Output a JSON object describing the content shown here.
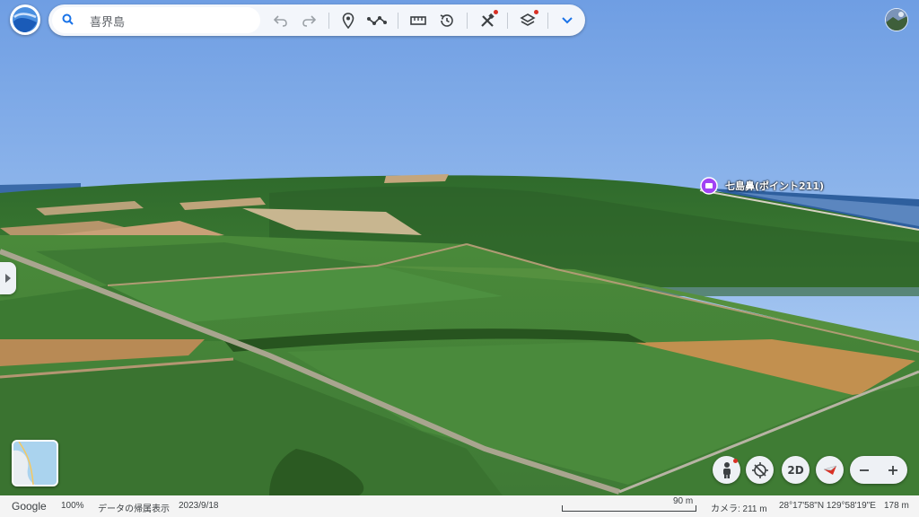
{
  "search": {
    "value": "喜界島"
  },
  "icons": {
    "logo": "google-earth-logo-icon",
    "search": "search-icon",
    "undo": "undo-icon",
    "redo": "redo-icon",
    "pin": "add-placemark-icon",
    "path": "draw-path-icon",
    "measure": "ruler-icon",
    "history": "historical-imagery-icon",
    "tools": "tools-icon",
    "layers": "layers-icon",
    "expand": "chevron-down-icon",
    "street_view": "pegman-icon",
    "compass": "compass-icon",
    "view_2d": "2d-toggle",
    "zoom_out": "minus-icon",
    "zoom_in": "plus-icon"
  },
  "place": {
    "label": "七島鼻(ポイント211)"
  },
  "controls": {
    "view_toggle": "2D"
  },
  "status": {
    "brand": "Google",
    "zoom": "100%",
    "attribution": "データの帰属表示",
    "date": "2023/9/18",
    "scale": "90 m",
    "camera": "カメラ: 211 m",
    "coords": "28°17'58\"N 129°58'19\"E",
    "elevation": "178 m"
  },
  "colors": {
    "accent": "#1a73e8",
    "notification": "#d93025",
    "sky": "#7aa6e6"
  }
}
